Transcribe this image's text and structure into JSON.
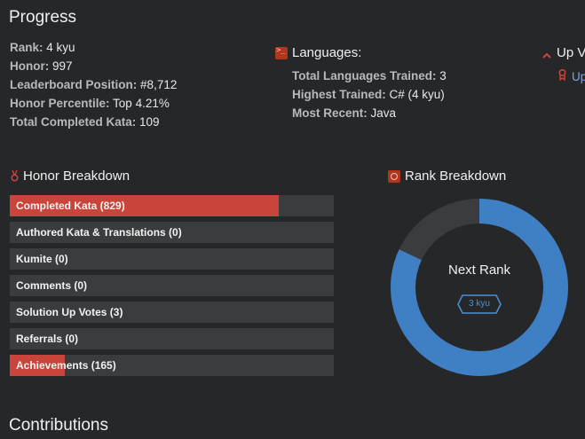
{
  "progress": {
    "title": "Progress",
    "items": [
      {
        "label": "Rank:",
        "value": "4 kyu"
      },
      {
        "label": "Honor:",
        "value": "997"
      },
      {
        "label": "Leaderboard Position:",
        "value": "#8,712"
      },
      {
        "label": "Honor Percentile:",
        "value": "Top 4.21%"
      },
      {
        "label": "Total Completed Kata:",
        "value": "109"
      }
    ]
  },
  "languages": {
    "title": "Languages:",
    "icon": "terminal-icon",
    "items": [
      {
        "label": "Total Languages Trained:",
        "value": "3"
      },
      {
        "label": "Highest Trained:",
        "value": "C# (4 kyu)"
      },
      {
        "label": "Most Recent:",
        "value": "Java"
      }
    ]
  },
  "upvotes": {
    "title": "Up V",
    "link_text": "Up"
  },
  "honor_breakdown": {
    "title": "Honor Breakdown",
    "accent": "#c9443a",
    "bars": [
      {
        "label": "Completed Kata (829)",
        "fill": 0.83
      },
      {
        "label": "Authored Kata & Translations (0)",
        "fill": 0
      },
      {
        "label": "Kumite (0)",
        "fill": 0
      },
      {
        "label": "Comments (0)",
        "fill": 0
      },
      {
        "label": "Solution Up Votes (3)",
        "fill": 0
      },
      {
        "label": "Referrals (0)",
        "fill": 0
      },
      {
        "label": "Achievements (165)",
        "fill": 0.17
      }
    ]
  },
  "rank_breakdown": {
    "title": "Rank Breakdown",
    "center_label": "Next Rank",
    "next_rank": "3 kyu",
    "progress_fraction": 0.82,
    "color_progress": "#3f7fc4",
    "color_remaining": "#3b3c3e"
  },
  "contributions": {
    "title": "Contributions"
  }
}
